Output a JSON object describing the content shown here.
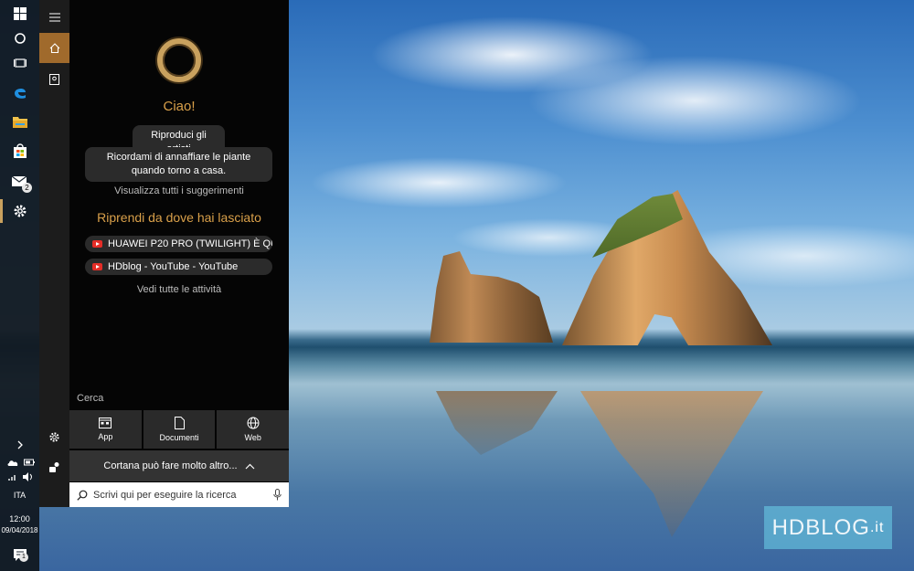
{
  "colors": {
    "accent": "#c9a15e",
    "cortana_text": "#d9a04a",
    "taskbar": "#121a22",
    "panel_bg": "#050505",
    "chip_bg": "#2b2b2b"
  },
  "taskbar": {
    "icons": [
      "windows-start-icon",
      "cortana-circle-icon",
      "task-view-icon",
      "edge-icon",
      "file-explorer-icon",
      "store-icon",
      "mail-icon",
      "settings-gear-icon"
    ],
    "mail_badge": "2",
    "language": "ITA",
    "time": "12:00",
    "date": "09/04/2018",
    "notification_badge": "1"
  },
  "sidebar": {
    "icons": [
      "hamburger-menu-icon",
      "home-icon",
      "notebook-icon",
      "settings-icon",
      "feedback-icon"
    ]
  },
  "cortana": {
    "greeting": "Ciao!",
    "suggestions": [
      "Riproduci gli artisti",
      "Ricordami di annaffiare le piante quando torno a casa."
    ],
    "all_suggestions_link": "Visualizza tutti i suggerimenti",
    "resume_title": "Riprendi da dove hai lasciato",
    "activities": [
      "HUAWEI P20 PRO (TWILIGHT) È QU...",
      "HDblog - YouTube - YouTube"
    ],
    "all_activities_link": "Vedi tutte le attività",
    "search_label": "Cerca",
    "filters": [
      "App",
      "Documenti",
      "Web"
    ],
    "more_label": "Cortana può fare molto altro..."
  },
  "search": {
    "placeholder": "Scrivi qui per eseguire la ricerca"
  },
  "watermark": {
    "brand": "HDBLOG",
    "suffix": ".it"
  }
}
